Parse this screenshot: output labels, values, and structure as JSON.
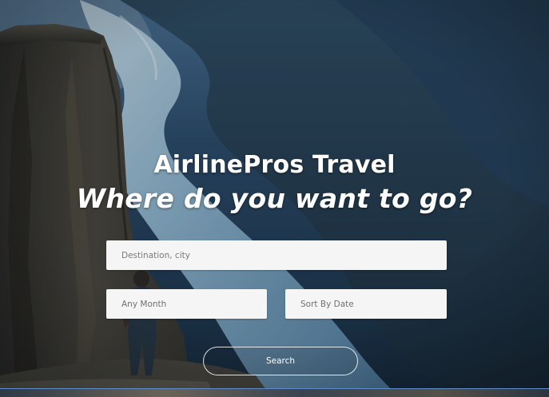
{
  "hero": {
    "title": "AirlinePros Travel",
    "tagline": "Where do you want to go?"
  },
  "form": {
    "destination_placeholder": "Destination, city",
    "month_value": "Any Month",
    "sort_value": "Sort By Date",
    "search_label": "Search"
  },
  "colors": {
    "field_bg": "#f5f5f5",
    "text_light": "#ffffff",
    "placeholder_text": "#707070",
    "sky": "#22384f",
    "water": "#8fb6cf"
  },
  "icons": {
    "background": "fjord-cliff-photo"
  }
}
